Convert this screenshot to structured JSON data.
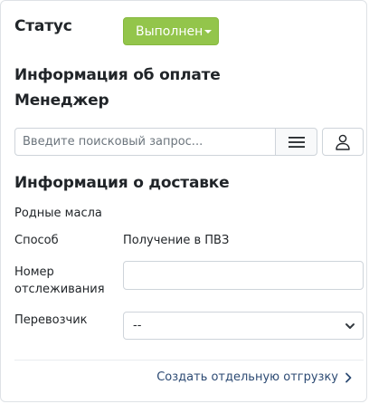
{
  "status": {
    "label": "Статус",
    "value": "Выполнен",
    "color": "#93c54b"
  },
  "payment": {
    "heading": "Информация об оплате"
  },
  "manager": {
    "heading": "Менеджер",
    "search_placeholder": "Введите поисковый запрос...",
    "menu_icon": "hamburger-icon",
    "user_icon": "user-icon"
  },
  "delivery": {
    "heading": "Информация о доставке",
    "warehouse": "Родные масла",
    "method_label": "Способ",
    "method_value": "Получение в ПВЗ",
    "tracking_label_line1": "Номер",
    "tracking_label_line2": "отслеживания",
    "tracking_value": "",
    "carrier_label": "Перевозчик",
    "carrier_value": "--"
  },
  "footer": {
    "link_label": "Создать отдельную отгрузку",
    "link_color": "#2c4a73"
  }
}
